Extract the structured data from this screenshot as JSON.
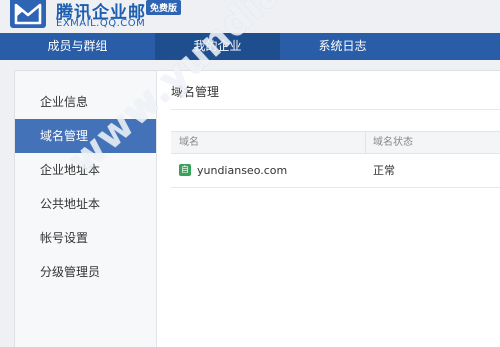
{
  "brand": {
    "name": "腾讯企业邮",
    "domain": "EXMAIL.QQ.COM",
    "badge": "免费版"
  },
  "nav": {
    "items": [
      {
        "label": "成员与群组"
      },
      {
        "label": "我的企业"
      },
      {
        "label": "系统日志"
      }
    ],
    "active_index": 1
  },
  "sidebar": {
    "items": [
      {
        "label": "企业信息"
      },
      {
        "label": "域名管理"
      },
      {
        "label": "企业地址本"
      },
      {
        "label": "公共地址本"
      },
      {
        "label": "帐号设置"
      },
      {
        "label": "分级管理员"
      }
    ],
    "active_index": 1
  },
  "main": {
    "title": "域名管理",
    "table": {
      "headers": [
        "域名",
        "域名状态"
      ],
      "rows": [
        {
          "icon_label": "自",
          "domain": "yundianseo.com",
          "status": "正常"
        }
      ]
    }
  },
  "watermark": {
    "text": "www.yundianseo.com"
  },
  "colors": {
    "nav_bg": "#2a5da8",
    "nav_active": "#1f4e8f",
    "sidebar_active": "#4372b8",
    "brand_blue": "#1f5fb2",
    "domain_icon": "#3aa35a"
  }
}
